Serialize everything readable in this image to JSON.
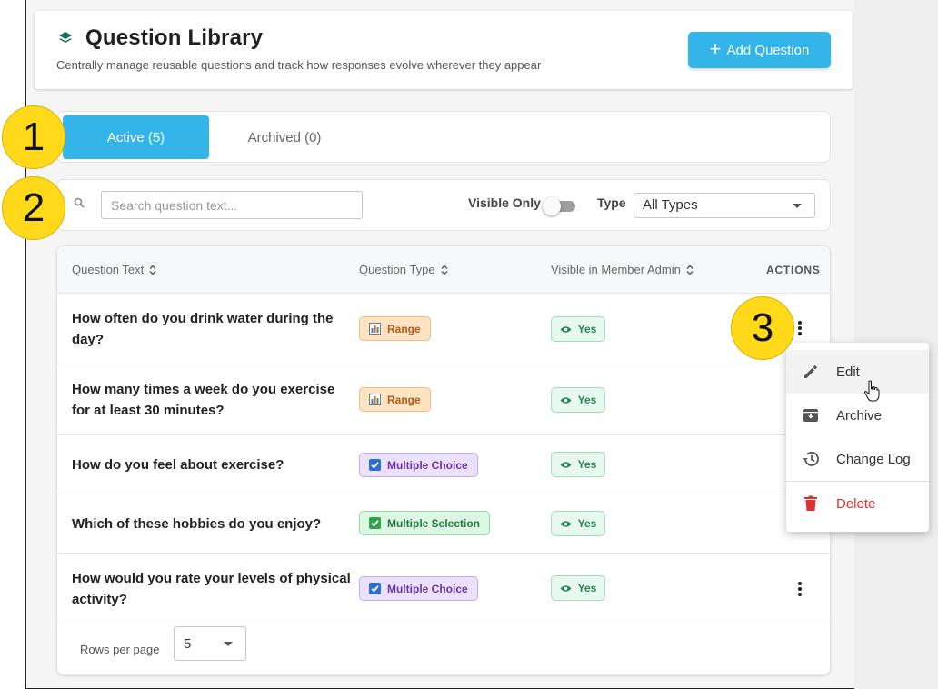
{
  "header": {
    "title": "Question Library",
    "subtitle": "Centrally manage reusable questions and track how responses evolve wherever they appear",
    "add_button": "Add Question"
  },
  "tabs": [
    {
      "label": "Active (5)",
      "active": true
    },
    {
      "label": "Archived (0)",
      "active": false
    }
  ],
  "filters": {
    "search_placeholder": "Search question text...",
    "visible_only_label": "Visible Only",
    "visible_only_on": false,
    "type_label": "Type",
    "type_value": "All Types"
  },
  "table": {
    "columns": [
      "Question Text",
      "Question Type",
      "Visible in Member Admin",
      "ACTIONS"
    ],
    "rows": [
      {
        "text": "How often do you drink water during the day?",
        "type": "Range",
        "visible": "Yes"
      },
      {
        "text": "How many times a week do you exercise for at least 30 minutes?",
        "type": "Range",
        "visible": "Yes"
      },
      {
        "text": "How do you feel about exercise?",
        "type": "Multiple Choice",
        "visible": "Yes"
      },
      {
        "text": "Which of these hobbies do you enjoy?",
        "type": "Multiple Selection",
        "visible": "Yes"
      },
      {
        "text": "How would you rate your levels of physical activity?",
        "type": "Multiple Choice",
        "visible": "Yes"
      }
    ],
    "rows_per_page_label": "Rows per page",
    "rows_per_page_value": "5"
  },
  "actions_menu": {
    "items": [
      {
        "label": "Edit",
        "icon": "pencil-icon"
      },
      {
        "label": "Archive",
        "icon": "archive-icon"
      },
      {
        "label": "Change Log",
        "icon": "history-icon"
      },
      {
        "label": "Delete",
        "icon": "trash-icon"
      }
    ]
  },
  "markers": [
    "1",
    "2",
    "3"
  ],
  "colors": {
    "primary": "#33b5ea",
    "range_badge": "#fde3c4",
    "multiple_choice_badge": "#ece1fb",
    "multiple_selection_badge": "#dcf7e2",
    "yes_badge": "#e7f8ef",
    "delete": "#e0302e",
    "marker": "#ffd91a"
  }
}
